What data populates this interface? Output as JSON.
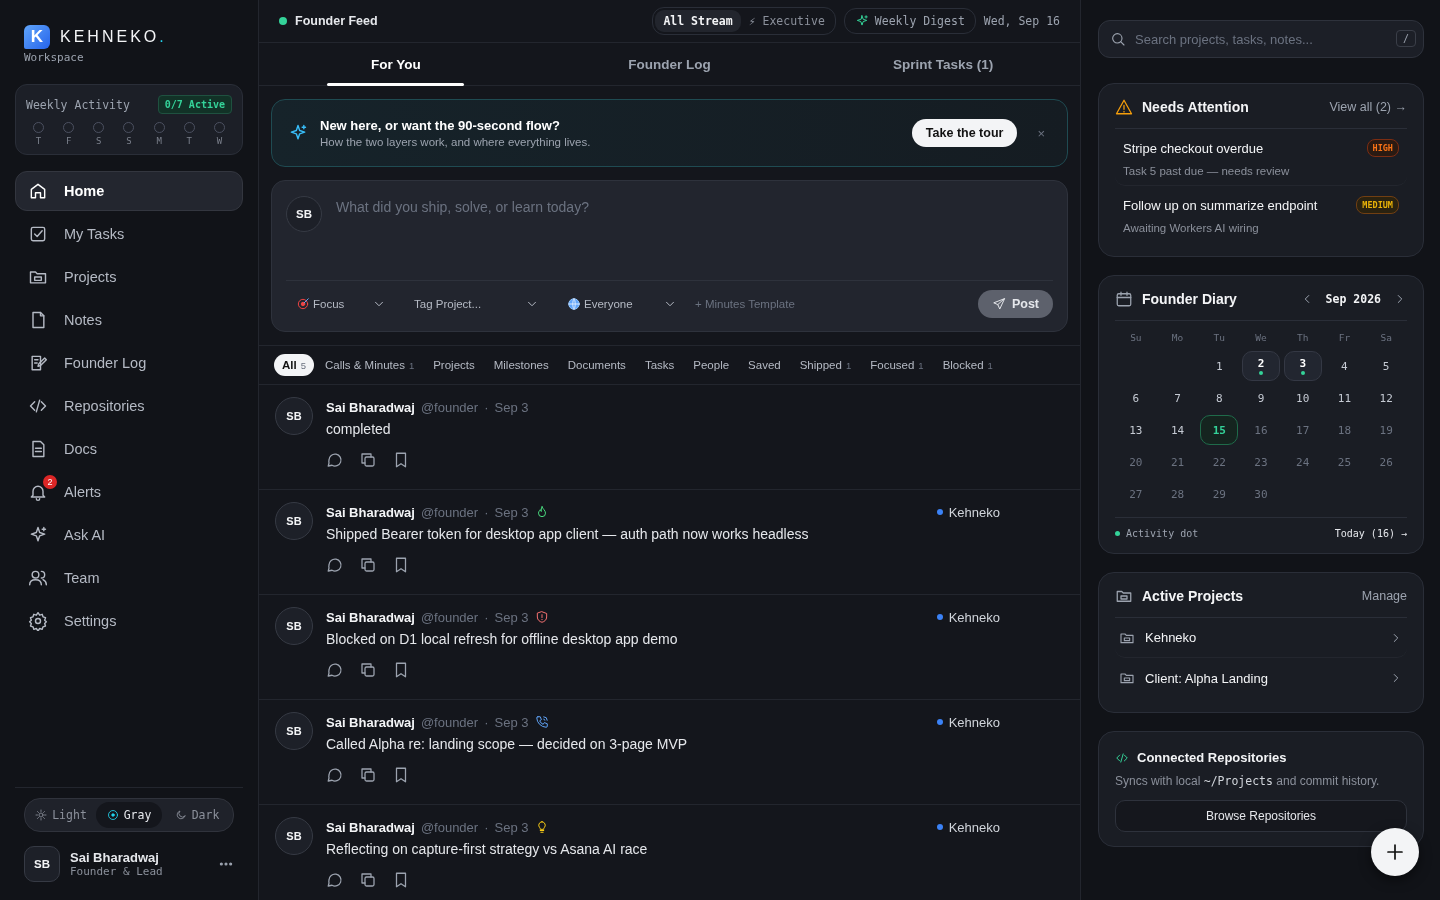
{
  "brand": {
    "name": "KEHNEKO",
    "dot": ".",
    "subtitle": "Workspace",
    "logo_letter": "K"
  },
  "weekly_activity": {
    "title": "Weekly Activity",
    "badge": "0/7 Active",
    "days": [
      {
        "label": "T",
        "active": false
      },
      {
        "label": "F",
        "active": false
      },
      {
        "label": "S",
        "active": false
      },
      {
        "label": "S",
        "active": false
      },
      {
        "label": "M",
        "active": false
      },
      {
        "label": "T",
        "active": false
      },
      {
        "label": "W",
        "active": false
      }
    ]
  },
  "nav": [
    {
      "kind": "home",
      "label": "Home",
      "selected": true
    },
    {
      "kind": "tasks",
      "label": "My Tasks",
      "selected": false
    },
    {
      "kind": "folder",
      "label": "Projects",
      "selected": false
    },
    {
      "kind": "note",
      "label": "Notes",
      "selected": false
    },
    {
      "kind": "log",
      "label": "Founder Log",
      "selected": false
    },
    {
      "kind": "code",
      "label": "Repositories",
      "selected": false
    },
    {
      "kind": "doc",
      "label": "Docs",
      "selected": false
    },
    {
      "kind": "bell",
      "label": "Alerts",
      "selected": false,
      "badge": "2"
    },
    {
      "kind": "sparkle",
      "label": "Ask AI",
      "selected": false
    },
    {
      "kind": "team",
      "label": "Team",
      "selected": false
    },
    {
      "kind": "gear",
      "label": "Settings",
      "selected": false
    }
  ],
  "theme": [
    {
      "kind": "sun",
      "label": "Light",
      "selected": false
    },
    {
      "kind": "circle",
      "label": "Gray",
      "selected": true
    },
    {
      "kind": "moon",
      "label": "Dark",
      "selected": false
    }
  ],
  "user": {
    "initials": "SB",
    "name": "Sai Bharadwaj",
    "role": "Founder & Lead"
  },
  "header": {
    "title": "Founder Feed",
    "modes": [
      {
        "label": "All Stream",
        "selected": true
      },
      {
        "label": "⚡ Executive",
        "selected": false
      }
    ],
    "digest": "Weekly Digest",
    "date": "Wed, Sep 16"
  },
  "tabs": [
    {
      "label": "For You",
      "selected": true
    },
    {
      "label": "Founder Log",
      "selected": false
    },
    {
      "label": "Sprint Tasks (1)",
      "selected": false
    }
  ],
  "banner": {
    "title": "New here, or want the 90-second flow?",
    "text": "How the two layers work, and where everything lives.",
    "button": "Take the tour",
    "close": "×"
  },
  "composer": {
    "initials": "SB",
    "placeholder": "What did you ship, solve, or learn today?",
    "selects": [
      {
        "kind": "target",
        "label": "Focus"
      },
      {
        "kind": "none",
        "label": "Tag Project..."
      },
      {
        "kind": "globe",
        "label": "Everyone"
      }
    ],
    "template": "+ Minutes Template",
    "post": "Post",
    "disabled": true
  },
  "filters": [
    {
      "label": "All",
      "count": "5",
      "selected": true
    },
    {
      "label": "Calls & Minutes",
      "count": "1",
      "selected": false
    },
    {
      "label": "Projects",
      "selected": false
    },
    {
      "label": "Milestones",
      "selected": false
    },
    {
      "label": "Documents",
      "selected": false
    },
    {
      "label": "Tasks",
      "selected": false
    },
    {
      "label": "People",
      "selected": false
    },
    {
      "label": "Saved",
      "selected": false
    },
    {
      "label": "Shipped",
      "count": "1",
      "selected": false
    },
    {
      "label": "Focused",
      "count": "1",
      "selected": false
    },
    {
      "label": "Blocked",
      "count": "1",
      "selected": false
    }
  ],
  "posts": [
    {
      "initials": "SB",
      "author": "Sai Bharadwaj",
      "handle": "@founder",
      "separator": "·",
      "date": "Sep 3",
      "kind": "none",
      "text": "completed"
    },
    {
      "initials": "SB",
      "author": "Sai Bharadwaj",
      "handle": "@founder",
      "separator": "·",
      "date": "Sep 3",
      "kind": "shipped",
      "text": "Shipped Bearer token for desktop app client — auth path now works headless",
      "project": {
        "name": "Kehneko",
        "color": "#3b82f6"
      }
    },
    {
      "initials": "SB",
      "author": "Sai Bharadwaj",
      "handle": "@founder",
      "separator": "·",
      "date": "Sep 3",
      "kind": "blocked",
      "text": "Blocked on D1 local refresh for offline desktop app demo",
      "project": {
        "name": "Kehneko",
        "color": "#3b82f6"
      }
    },
    {
      "initials": "SB",
      "author": "Sai Bharadwaj",
      "handle": "@founder",
      "separator": "·",
      "date": "Sep 3",
      "kind": "call",
      "text": "Called Alpha re: landing scope — decided on 3-page MVP",
      "project": {
        "name": "Kehneko",
        "color": "#3b82f6"
      }
    },
    {
      "initials": "SB",
      "author": "Sai Bharadwaj",
      "handle": "@founder",
      "separator": "·",
      "date": "Sep 3",
      "kind": "idea",
      "text": "Reflecting on capture-first strategy vs Asana AI race",
      "project": {
        "name": "Kehneko",
        "color": "#3b82f6"
      }
    }
  ],
  "search": {
    "placeholder": "Search projects, tasks, notes...",
    "shortcut": "/"
  },
  "attention": {
    "title": "Needs Attention",
    "link": "View all (2) →",
    "items": [
      {
        "title": "Stripe checkout overdue",
        "text": "Task 5 past due — needs review",
        "priority": "HIGH",
        "kind": "high"
      },
      {
        "title": "Follow up on summarize endpoint",
        "text": "Awaiting Workers AI wiring",
        "priority": "MEDIUM",
        "kind": "medium"
      }
    ]
  },
  "diary": {
    "title": "Founder Diary",
    "month": "Sep 2026",
    "weekdays": [
      "Su",
      "Mo",
      "Tu",
      "We",
      "Th",
      "Fr",
      "Sa"
    ],
    "days": [
      {
        "kind": "blank"
      },
      {
        "kind": "blank"
      },
      {
        "kind": "day",
        "day": "1",
        "dimmed": false,
        "activity": false,
        "selected": false
      },
      {
        "kind": "day",
        "day": "2",
        "dimmed": false,
        "activity": true,
        "selected": false
      },
      {
        "kind": "day",
        "day": "3",
        "dimmed": false,
        "activity": true,
        "selected": false
      },
      {
        "kind": "day",
        "day": "4",
        "dimmed": false,
        "activity": false,
        "selected": false
      },
      {
        "kind": "day",
        "day": "5",
        "dimmed": false,
        "activity": false,
        "selected": false
      },
      {
        "kind": "day",
        "day": "6",
        "dimmed": false,
        "activity": false,
        "selected": false
      },
      {
        "kind": "day",
        "day": "7",
        "dimmed": false,
        "activity": false,
        "selected": false
      },
      {
        "kind": "day",
        "day": "8",
        "dimmed": false,
        "activity": false,
        "selected": false
      },
      {
        "kind": "day",
        "day": "9",
        "dimmed": false,
        "activity": false,
        "selected": false
      },
      {
        "kind": "day",
        "day": "10",
        "dimmed": false,
        "activity": false,
        "selected": false
      },
      {
        "kind": "day",
        "day": "11",
        "dimmed": false,
        "activity": false,
        "selected": false
      },
      {
        "kind": "day",
        "day": "12",
        "dimmed": false,
        "activity": false,
        "selected": false
      },
      {
        "kind": "day",
        "day": "13",
        "dimmed": false,
        "activity": false,
        "selected": false
      },
      {
        "kind": "day",
        "day": "14",
        "dimmed": false,
        "activity": false,
        "selected": false
      },
      {
        "kind": "day",
        "day": "15",
        "dimmed": false,
        "activity": false,
        "selected": true
      },
      {
        "kind": "day",
        "day": "16",
        "dimmed": true,
        "activity": false,
        "selected": false
      },
      {
        "kind": "day",
        "day": "17",
        "dimmed": true,
        "activity": false,
        "selected": false
      },
      {
        "kind": "day",
        "day": "18",
        "dimmed": true,
        "activity": false,
        "selected": false
      },
      {
        "kind": "day",
        "day": "19",
        "dimmed": true,
        "activity": false,
        "selected": false
      },
      {
        "kind": "day",
        "day": "20",
        "dimmed": true,
        "activity": false,
        "selected": false
      },
      {
        "kind": "day",
        "day": "21",
        "dimmed": true,
        "activity": false,
        "selected": false
      },
      {
        "kind": "day",
        "day": "22",
        "dimmed": true,
        "activity": false,
        "selected": false
      },
      {
        "kind": "day",
        "day": "23",
        "dimmed": true,
        "activity": false,
        "selected": false
      },
      {
        "kind": "day",
        "day": "24",
        "dimmed": true,
        "activity": false,
        "selected": false
      },
      {
        "kind": "day",
        "day": "25",
        "dimmed": true,
        "activity": false,
        "selected": false
      },
      {
        "kind": "day",
        "day": "26",
        "dimmed": true,
        "activity": false,
        "selected": false
      },
      {
        "kind": "day",
        "day": "27",
        "dimmed": true,
        "activity": false,
        "selected": false
      },
      {
        "kind": "day",
        "day": "28",
        "dimmed": true,
        "activity": false,
        "selected": false
      },
      {
        "kind": "day",
        "day": "29",
        "dimmed": true,
        "activity": false,
        "selected": false
      },
      {
        "kind": "day",
        "day": "30",
        "dimmed": true,
        "activity": false,
        "selected": false
      }
    ],
    "legend": "Activity dot",
    "today": "Today (16) →"
  },
  "projects": {
    "title": "Active Projects",
    "link": "Manage",
    "items": [
      {
        "name": "Kehneko"
      },
      {
        "name": "Client: Alpha Landing"
      }
    ]
  },
  "repos": {
    "title": "Connected Repositories",
    "text_before": "Syncs with local",
    "path": "~/Projects",
    "text_after": "and commit history.",
    "button": "Browse Repositories"
  }
}
